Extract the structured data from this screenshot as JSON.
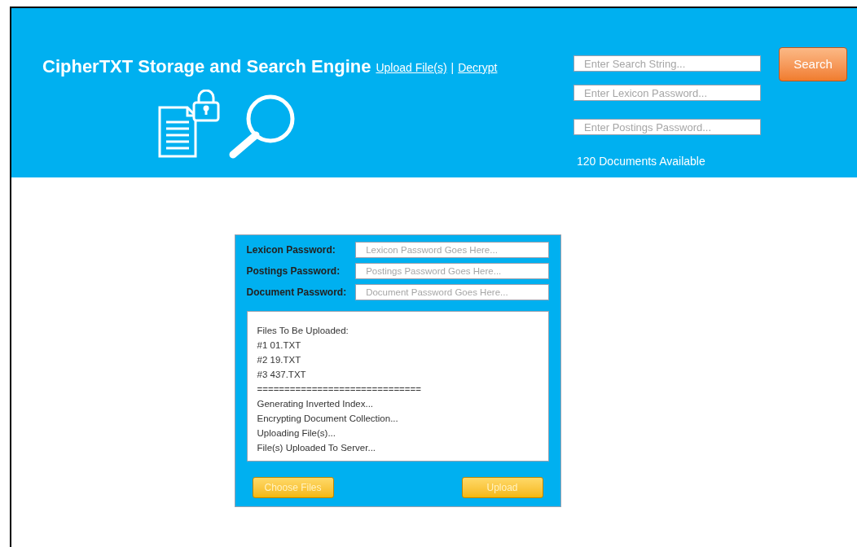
{
  "header": {
    "title": "CipherTXT Storage and Search Engine",
    "links": [
      {
        "label": "Upload File(s)"
      },
      {
        "label": "|",
        "kind": "separator"
      },
      {
        "label": "Decrypt"
      }
    ],
    "fields": [
      {
        "placeholder": "Enter Search String..."
      },
      {
        "placeholder": "Enter Lexicon Password..."
      },
      {
        "placeholder": "Enter Postings Password..."
      }
    ],
    "search_button": "Search",
    "status": "120 Documents Available"
  },
  "upload_panel": {
    "fields": [
      {
        "label": "Lexicon Password:",
        "placeholder": "Lexicon Password Goes Here..."
      },
      {
        "label": "Postings Password:",
        "placeholder": "Postings Password Goes Here..."
      },
      {
        "label": "Document Password:",
        "placeholder": "Document Password Goes Here..."
      }
    ],
    "log": [
      "Files To Be Uploaded:",
      "#1 01.TXT",
      "#2 19.TXT",
      "#3 437.TXT",
      "==============================",
      "Generating Inverted Index...",
      "Encrypting Document Collection...",
      "Uploading File(s)...",
      "File(s) Uploaded To Server..."
    ],
    "buttons": [
      "Choose Files",
      "Upload"
    ]
  }
}
